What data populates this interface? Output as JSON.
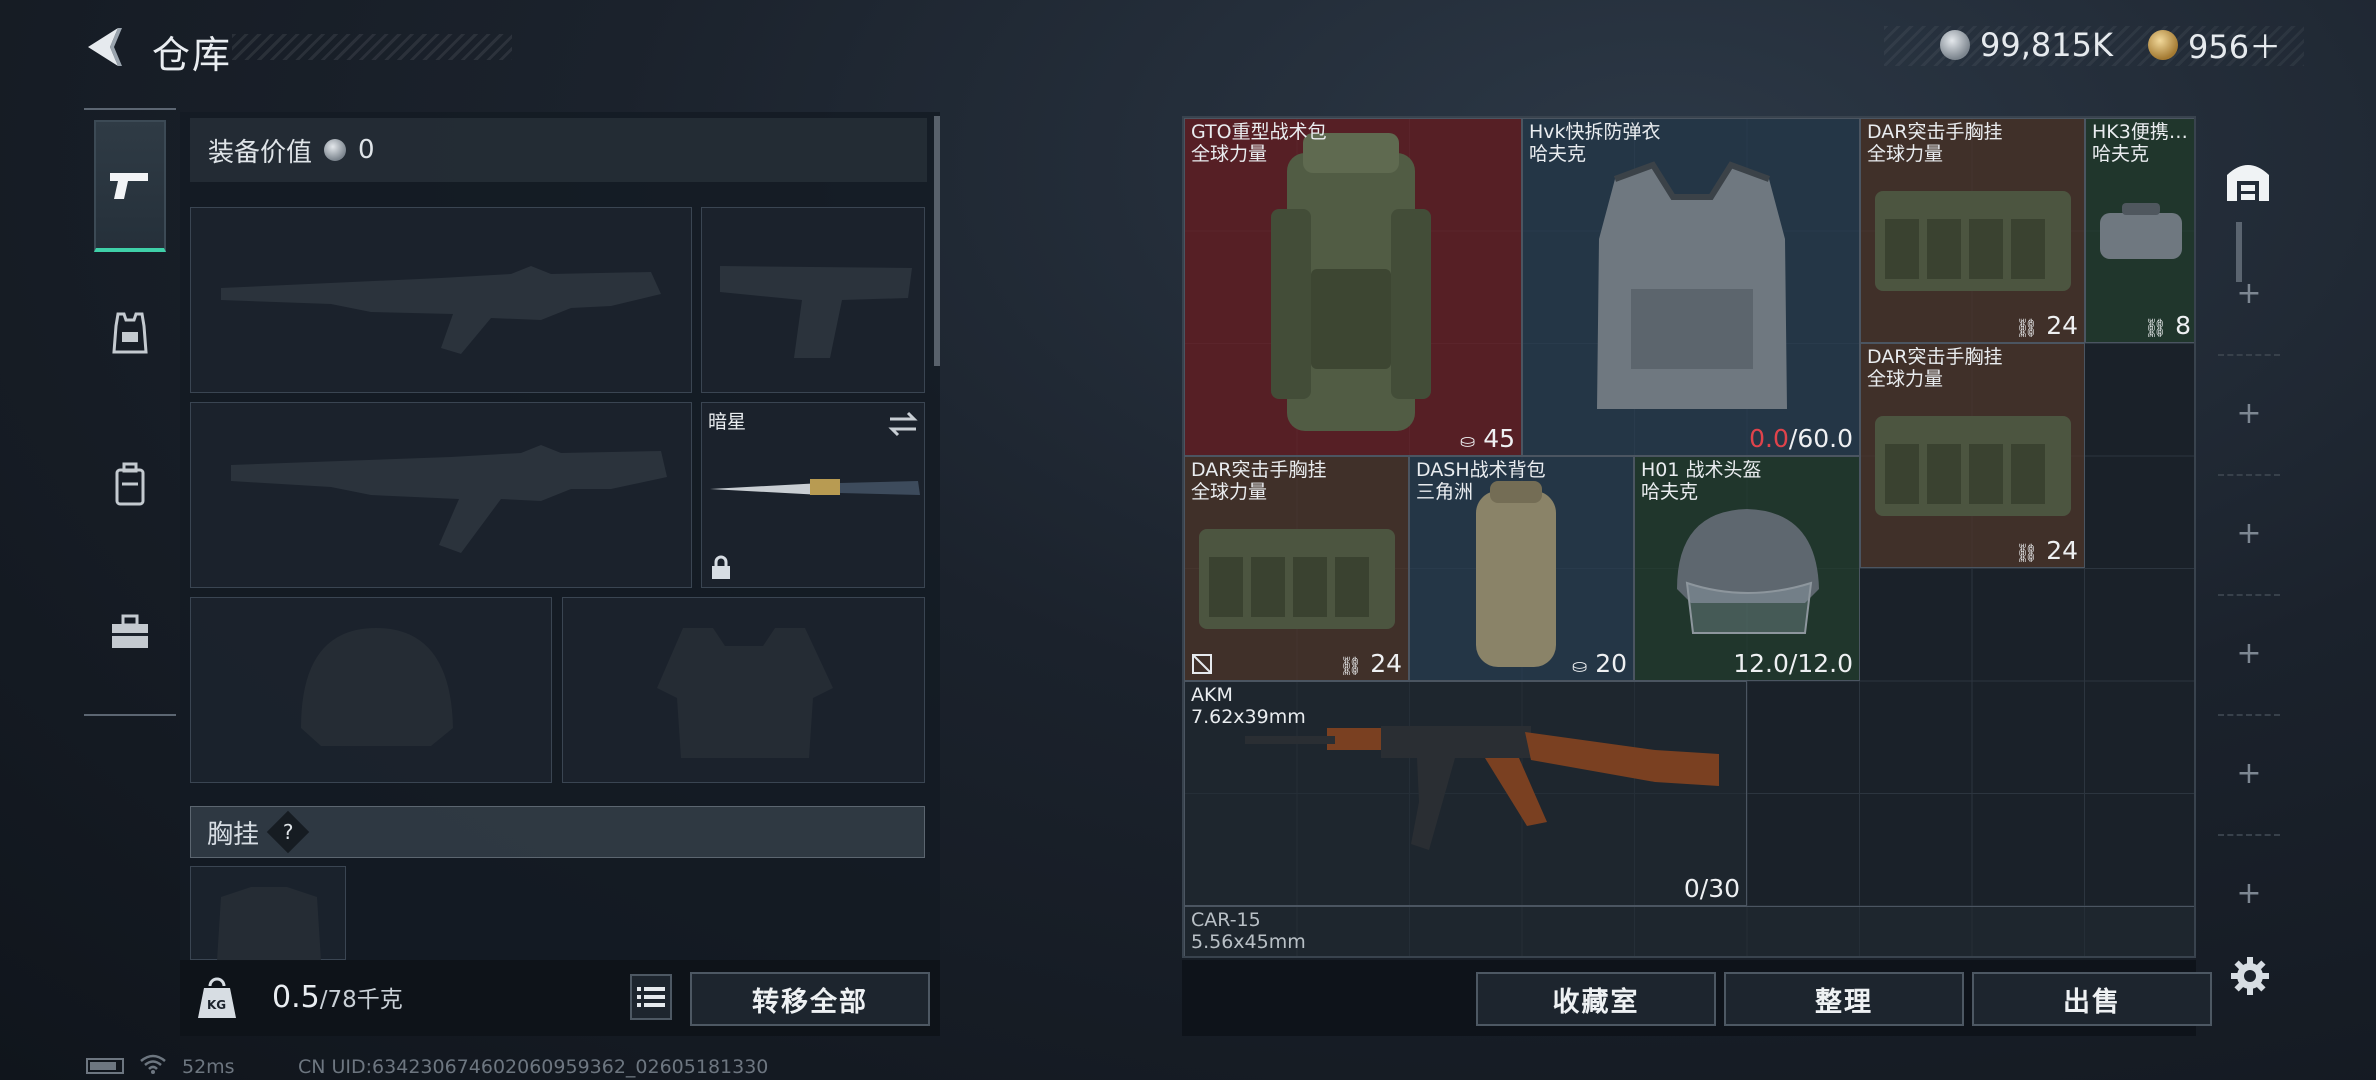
{
  "header": {
    "title": "仓库"
  },
  "currency": [
    {
      "icon": "silver-coin-icon",
      "value": "99,815K",
      "color": "#9aa3ab"
    },
    {
      "icon": "gold-triangle-coin-icon",
      "value": "956＋",
      "color": "#c9a45a"
    }
  ],
  "tabs": [
    {
      "icon": "pistol-icon",
      "active": true
    },
    {
      "icon": "vest-icon",
      "active": false
    },
    {
      "icon": "backpack-icon",
      "active": false
    },
    {
      "icon": "toolbox-icon",
      "active": false
    }
  ],
  "loadout": {
    "equip_value_label": "装备价值",
    "equip_value": "0",
    "melee_name": "暗星",
    "chest_rig_label": "胸挂",
    "help": "?",
    "weight_current": "0.5",
    "weight_max": "/78千克",
    "weight_badge": "KG",
    "transfer_all": "转移全部"
  },
  "storage_items": [
    {
      "name": "GTO重型战术包",
      "sub": "全球力量",
      "value": "45",
      "color": "red"
    },
    {
      "name": "Hvk快拆防弹衣",
      "sub": "哈夫克",
      "value_red": "0.0",
      "value": "/60.0",
      "color": "blue"
    },
    {
      "name": "DAR突击手胸挂",
      "sub": "全球力量",
      "value": "24",
      "color": "brown"
    },
    {
      "name": "HK3便携…",
      "sub": "哈夫克",
      "value": "8",
      "color": "green"
    },
    {
      "name": "DAR突击手胸挂",
      "sub": "全球力量",
      "value": "24",
      "color": "brown"
    },
    {
      "name": "DAR突击手胸挂",
      "sub": "全球力量",
      "value": "24",
      "color": "brown"
    },
    {
      "name": "DASH战术背包",
      "sub": "三角洲",
      "value": "20",
      "color": "blue"
    },
    {
      "name": "H01 战术头盔",
      "sub": "哈夫克",
      "value": "12.0/12.0",
      "color": "green"
    },
    {
      "name": "AKM",
      "sub": "7.62x39mm",
      "value": "0/30",
      "color": "gray"
    },
    {
      "name": "CAR-15",
      "sub": "5.56x45mm",
      "value": "",
      "color": "gray"
    }
  ],
  "actions": {
    "collection": "收藏室",
    "sort": "整理",
    "sell": "出售"
  },
  "status": {
    "ping": "52ms",
    "uid": "CN UID:634230674602060959362_02605181330"
  }
}
